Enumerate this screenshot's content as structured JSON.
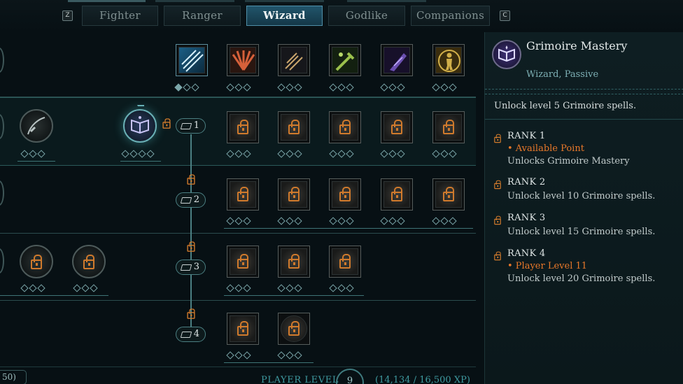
{
  "tabs": {
    "prev_key": "Z",
    "next_key": "C",
    "items": [
      {
        "label": "Fighter"
      },
      {
        "label": "Ranger"
      },
      {
        "label": "Wizard",
        "active": true
      },
      {
        "label": "Godlike"
      },
      {
        "label": "Companions"
      }
    ]
  },
  "tree": {
    "rank_labels": [
      "1",
      "2",
      "3",
      "4"
    ],
    "rows": [
      {
        "name": "top-row",
        "abilities": [
          "blade-slash-ability",
          "fan-blades-ability",
          "dagger-throw-ability",
          "poison-hand-ability",
          "dark-crystal-ability",
          "golden-figure-ability"
        ]
      },
      {
        "name": "rank-1-row",
        "abilities": [
          "locked-ability",
          "locked-ability",
          "locked-ability",
          "locked-ability",
          "locked-ability"
        ]
      },
      {
        "name": "rank-2-row",
        "abilities": [
          "locked-ability",
          "locked-ability",
          "locked-ability",
          "locked-ability",
          "locked-ability"
        ]
      },
      {
        "name": "rank-3-row",
        "abilities": [
          "locked-ability",
          "locked-ability",
          "locked-ability"
        ]
      },
      {
        "name": "rank-4-row",
        "abilities": [
          "locked-ability",
          "locked-ability"
        ]
      }
    ]
  },
  "status": {
    "points": "50)",
    "player_level_label": "PLAYER LEVEL",
    "player_level": "9",
    "xp": "(14,134 / 16,500 XP)"
  },
  "panel": {
    "title": "Grimoire Mastery",
    "subtitle": "Wizard, Passive",
    "description": "Unlock level 5 Grimoire spells.",
    "icon": "grimoire-book-icon",
    "ranks": [
      {
        "title": "RANK 1",
        "orange": "• Available Point",
        "text": "Unlocks Grimoire Mastery"
      },
      {
        "title": "RANK 2",
        "orange": "",
        "text": "Unlock level 10 Grimoire spells."
      },
      {
        "title": "RANK 3",
        "orange": "",
        "text": "Unlock level 15 Grimoire spells."
      },
      {
        "title": "RANK 4",
        "orange": "• Player Level 11",
        "text": "Unlock level 20 Grimoire spells."
      }
    ]
  },
  "colors": {
    "accent_teal": "#4f8fa8",
    "orange": "#e8782a",
    "background": "#071014"
  }
}
